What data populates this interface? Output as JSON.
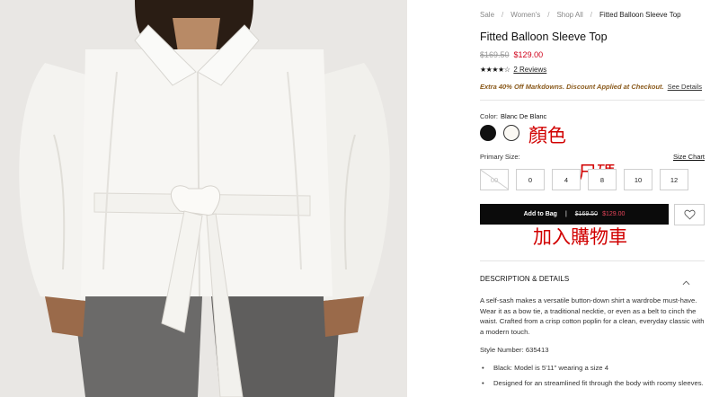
{
  "breadcrumb": [
    "Sale",
    "Women's",
    "Shop All",
    "Fitted Balloon Sleeve Top"
  ],
  "product": {
    "title": "Fitted Balloon Sleeve Top",
    "price_original": "$169.50",
    "price_sale": "$129.00",
    "rating": 4,
    "stars": "★★★★☆",
    "reviews_label": "2 Reviews",
    "promo_text": "Extra 40% Off Markdowns. Discount Applied at Checkout.",
    "promo_link": "See Details",
    "color_label": "Color:",
    "color_value": "Blanc De Blanc",
    "swatches": [
      {
        "name": "black",
        "color": "#111111"
      },
      {
        "name": "blanc-de-blanc",
        "color": "#fbf9f4"
      }
    ],
    "size_label": "Primary Size:",
    "size_chart_label": "Size Chart",
    "sizes": [
      "00",
      "0",
      "4",
      "8",
      "10",
      "12"
    ],
    "add_to_bag": {
      "label": "Add to Bag",
      "separator": "|",
      "old_price": "$169.50",
      "new_price": "$129.00"
    },
    "description": {
      "header": "DESCRIPTION & DETAILS",
      "body": "A self-sash makes a versatile button-down shirt a wardrobe must-have. Wear it as a bow tie, a traditional necktie, or even as a belt to cinch the waist. Crafted from a crisp cotton poplin for a clean, everyday classic with a modern touch.",
      "style_number": "Style Number: 635413",
      "bullets": [
        "Black: Model is 5'11\" wearing a size 4",
        "Designed for an streamlined fit through the body with roomy sleeves."
      ]
    }
  },
  "annotations": {
    "color": "顏色",
    "size": "尺碼",
    "add_to_cart": "加入購物車"
  },
  "colors": {
    "sale_red": "#d0021b",
    "promo_brown": "#8a5a1c",
    "annotation_red": "#d10000",
    "button_black": "#0b0b0b"
  },
  "icons": {
    "wishlist": "heart-icon",
    "collapse": "chevron-up-icon"
  }
}
